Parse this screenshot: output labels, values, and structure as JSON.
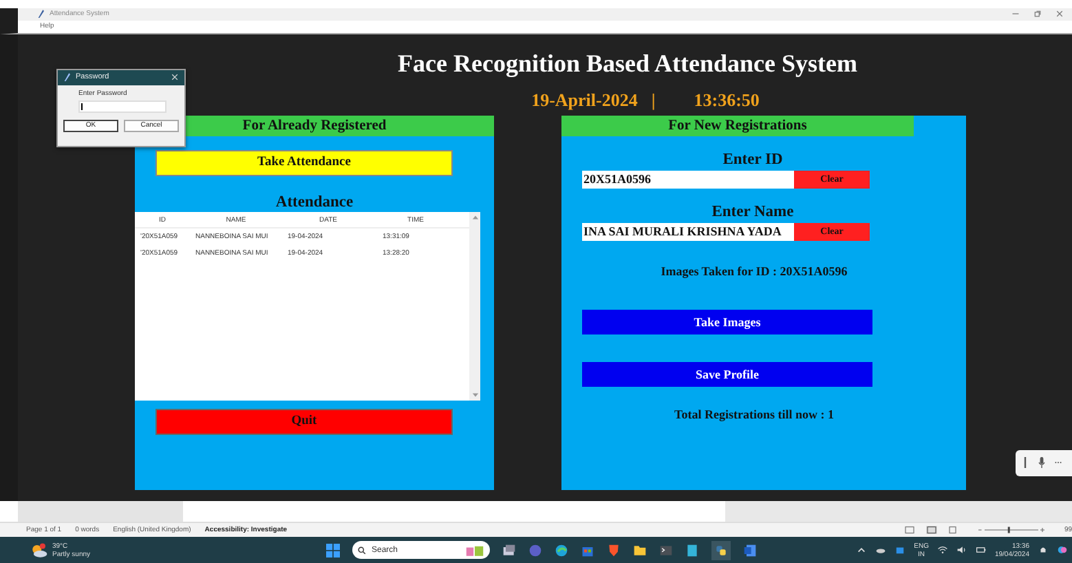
{
  "window": {
    "title": "Attendance System",
    "menu": [
      "Help"
    ]
  },
  "header": {
    "title": "Face Recognition Based Attendance System",
    "date": "19-April-2024",
    "separator": "|",
    "time": "13:36:50"
  },
  "password_dialog": {
    "title": "Password",
    "label": "Enter Password",
    "buttons": [
      "OK",
      "Cancel"
    ]
  },
  "registered_panel": {
    "heading": "For Already Registered",
    "take_attendance": "Take Attendance",
    "attendance_title": "Attendance",
    "table": {
      "columns": [
        "ID",
        "NAME",
        "DATE",
        "TIME"
      ],
      "rows": [
        [
          "'20X51A059",
          "NANNEBOINA SAI MUI",
          "19-04-2024",
          "13:31:09"
        ],
        [
          "'20X51A059",
          "NANNEBOINA SAI MUI",
          "19-04-2024",
          "13:28:20"
        ]
      ]
    },
    "quit": "Quit"
  },
  "new_panel": {
    "heading": "For New Registrations",
    "fields": [
      {
        "label": "Enter ID",
        "value": "20X51A0596",
        "clear": "Clear"
      },
      {
        "label": "Enter Name",
        "value": "INA SAI MURALI KRISHNA YADA",
        "clear": "Clear"
      }
    ],
    "images_status": "Images Taken for ID : 20X51A0596",
    "buttons": [
      "Take Images",
      "Save Profile"
    ],
    "total": "Total Registrations till now  : 1"
  },
  "word_status": {
    "items": [
      "Page 1 of 1",
      "0 words",
      "English (United Kingdom)",
      "Accessibility: Investigate"
    ],
    "zoom_slider": {
      "level": 0.45
    },
    "zoom": "99"
  },
  "taskbar": {
    "temperature": "39°C",
    "weather": "Partly sunny",
    "search": "Search",
    "language": "ENG",
    "region": "IN",
    "time": "13:36",
    "date": "19/04/2024"
  }
}
